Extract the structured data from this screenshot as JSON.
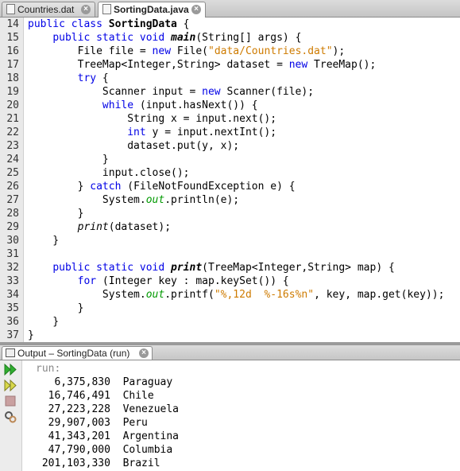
{
  "tabs": [
    {
      "label": "Countries.dat",
      "active": false
    },
    {
      "label": "SortingData.java",
      "active": true
    }
  ],
  "editor": {
    "lines": [
      {
        "n": "14",
        "html": "<span class=\"kw\">public class</span> <span class=\"b\">SortingData</span> {"
      },
      {
        "n": "15",
        "html": "    <span class=\"kw\">public static void</span> <span class=\"bi\">main</span>(String[] args) {"
      },
      {
        "n": "16",
        "html": "        File file = <span class=\"kw\">new</span> File(<span class=\"str\">\"data/Countries.dat\"</span>);"
      },
      {
        "n": "17",
        "html": "        TreeMap&lt;Integer,String&gt; dataset = <span class=\"kw\">new</span> TreeMap();"
      },
      {
        "n": "18",
        "html": "        <span class=\"kw\">try</span> {"
      },
      {
        "n": "19",
        "html": "            Scanner input = <span class=\"kw\">new</span> Scanner(file);"
      },
      {
        "n": "20",
        "html": "            <span class=\"kw\">while</span> (input.hasNext()) {"
      },
      {
        "n": "21",
        "html": "                String x = input.next();"
      },
      {
        "n": "22",
        "html": "                <span class=\"kw\">int</span> y = input.nextInt();"
      },
      {
        "n": "23",
        "html": "                dataset.put(y, x);"
      },
      {
        "n": "24",
        "html": "            }"
      },
      {
        "n": "25",
        "html": "            input.close();"
      },
      {
        "n": "26",
        "html": "        } <span class=\"kw\">catch</span> (FileNotFoundException e) {"
      },
      {
        "n": "27",
        "html": "            System.<span class=\"fld\">out</span>.println(e);"
      },
      {
        "n": "28",
        "html": "        }"
      },
      {
        "n": "29",
        "html": "        <span class=\"it\">print</span>(dataset);"
      },
      {
        "n": "30",
        "html": "    }"
      },
      {
        "n": "31",
        "html": ""
      },
      {
        "n": "32",
        "html": "    <span class=\"kw\">public static void</span> <span class=\"bi\">print</span>(TreeMap&lt;Integer,String&gt; map) {"
      },
      {
        "n": "33",
        "html": "        <span class=\"kw\">for</span> (Integer key : map.keySet()) {"
      },
      {
        "n": "34",
        "html": "            System.<span class=\"fld\">out</span>.printf(<span class=\"str\">\"%,12d  %-16s%n\"</span>, key, map.get(key));"
      },
      {
        "n": "35",
        "html": "        }"
      },
      {
        "n": "36",
        "html": "    }"
      },
      {
        "n": "37",
        "html": "}"
      }
    ]
  },
  "output": {
    "tab_label": "Output – SortingData (run)",
    "lines": [
      "run:",
      "   6,375,830  Paraguay",
      "  16,746,491  Chile",
      "  27,223,228  Venezuela",
      "  29,907,003  Peru",
      "  41,343,201  Argentina",
      "  47,790,000  Columbia",
      " 201,103,330  Brazil"
    ],
    "toolbar": [
      "rerun-icon",
      "rerun-with-options-icon",
      "stop-icon",
      "settings-icon"
    ]
  },
  "colors": {
    "keyword": "#0000e6",
    "string": "#ce7b00",
    "field": "#009900"
  }
}
